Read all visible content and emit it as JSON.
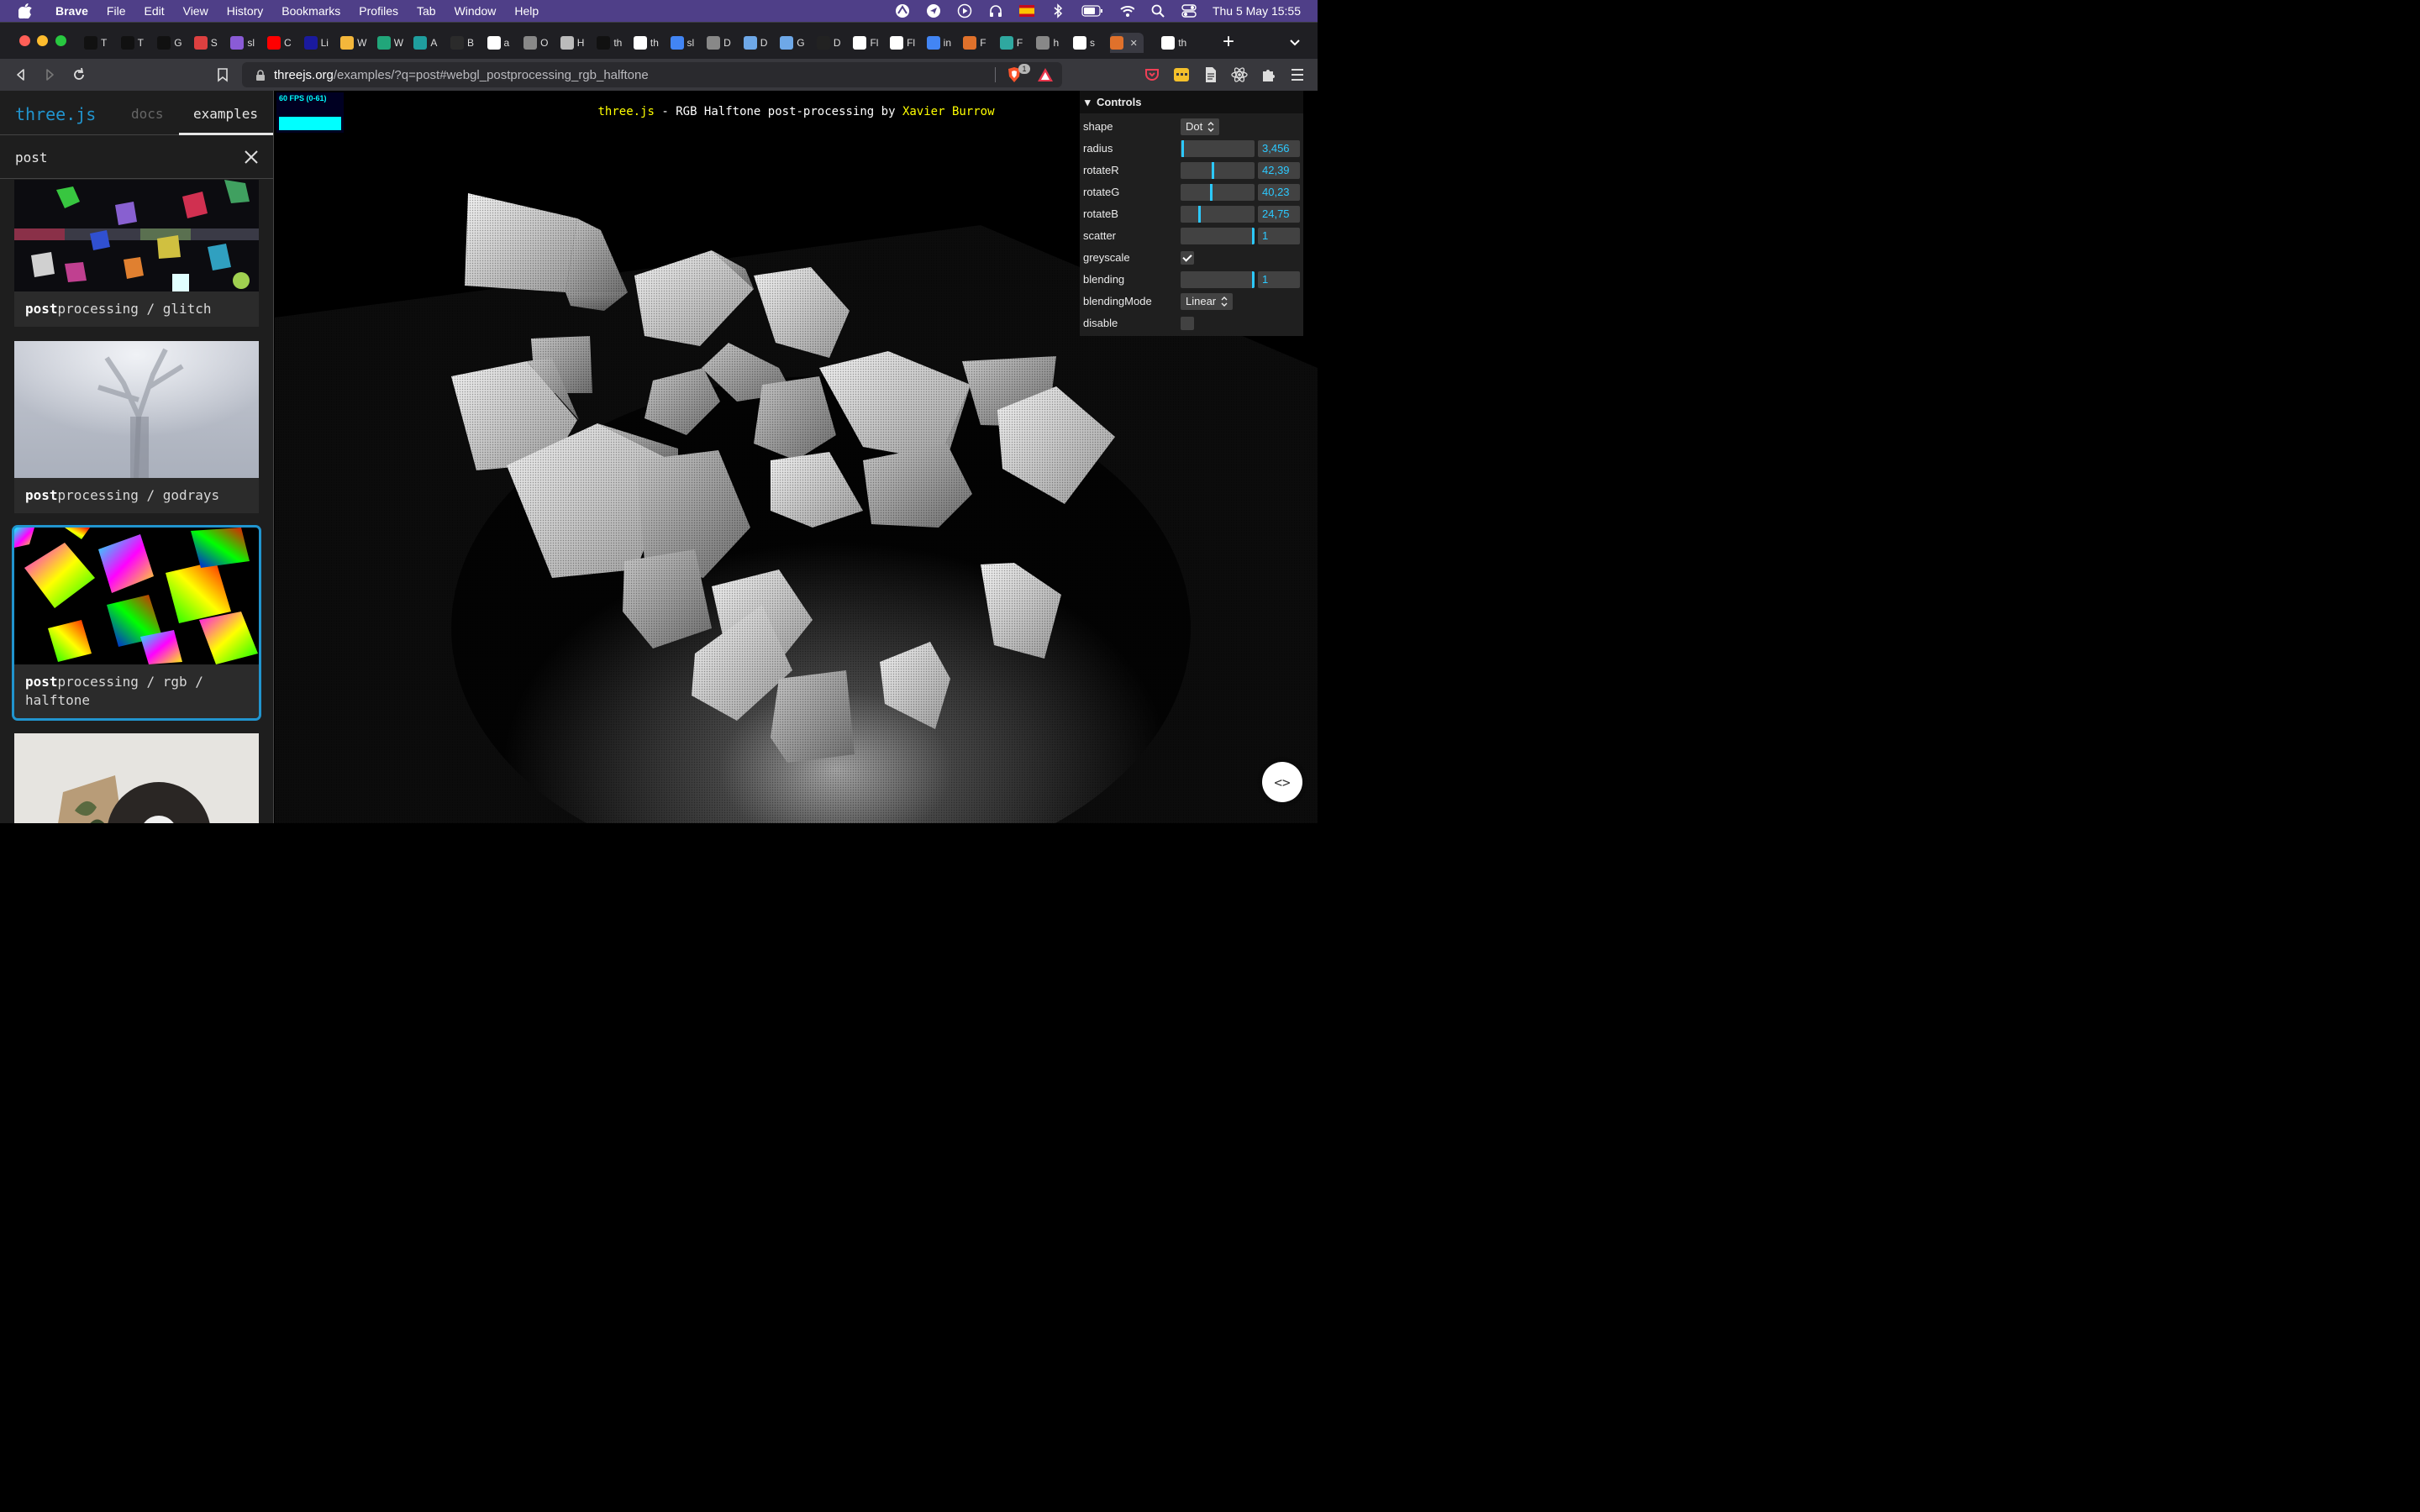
{
  "menubar": {
    "app_name": "Brave",
    "items": [
      "File",
      "Edit",
      "View",
      "History",
      "Bookmarks",
      "Profiles",
      "Tab",
      "Window",
      "Help"
    ],
    "clock": "Thu 5 May  15:55"
  },
  "tabs": {
    "letters": [
      "T",
      "T",
      "G",
      "S",
      "sl",
      "C",
      "Li",
      "W",
      "W",
      "A",
      "B",
      "a",
      "O",
      "H",
      "th",
      "th",
      "sl",
      "D",
      "D",
      "G",
      "D",
      "Fl",
      "Fl",
      "in",
      "F",
      "F",
      "h",
      "s",
      "",
      "th"
    ],
    "new_tab_label": "+"
  },
  "address": {
    "host": "threejs.org",
    "path": "/examples/?q=post#webgl_postprocessing_rgb_halftone",
    "shield_count": "1"
  },
  "sidebar": {
    "brand": "three.js",
    "nav_docs": "docs",
    "nav_examples": "examples",
    "search_value": "post",
    "cards": [
      {
        "match": "post",
        "rest": "processing / glitch"
      },
      {
        "match": "post",
        "rest": "processing / godrays"
      },
      {
        "match": "post",
        "rest": "processing / rgb / halftone"
      }
    ]
  },
  "viewport": {
    "stats": "60 FPS (0-61)",
    "info_link1": "three.js",
    "info_text": " - RGB Halftone post-processing by ",
    "info_link2": "Xavier Burrow",
    "source_button": "<>"
  },
  "gui": {
    "title": "Controls",
    "shape": {
      "label": "shape",
      "value": "Dot"
    },
    "radius": {
      "label": "radius",
      "value": "3,456",
      "fraction": 0.04
    },
    "rotateR": {
      "label": "rotateR",
      "value": "42,39",
      "fraction": 0.45
    },
    "rotateG": {
      "label": "rotateG",
      "value": "40,23",
      "fraction": 0.43
    },
    "rotateB": {
      "label": "rotateB",
      "value": "24,75",
      "fraction": 0.27
    },
    "scatter": {
      "label": "scatter",
      "value": "1",
      "fraction": 1.0
    },
    "greyscale": {
      "label": "greyscale",
      "checked": true
    },
    "blending": {
      "label": "blending",
      "value": "1",
      "fraction": 1.0
    },
    "blendingMode": {
      "label": "blendingMode",
      "value": "Linear"
    },
    "disable": {
      "label": "disable",
      "checked": false
    }
  },
  "colors": {
    "menubar": "#4f3f88",
    "accent": "#2194ce",
    "gui_number": "#2cc9ff",
    "info_link": "#ffff00"
  }
}
